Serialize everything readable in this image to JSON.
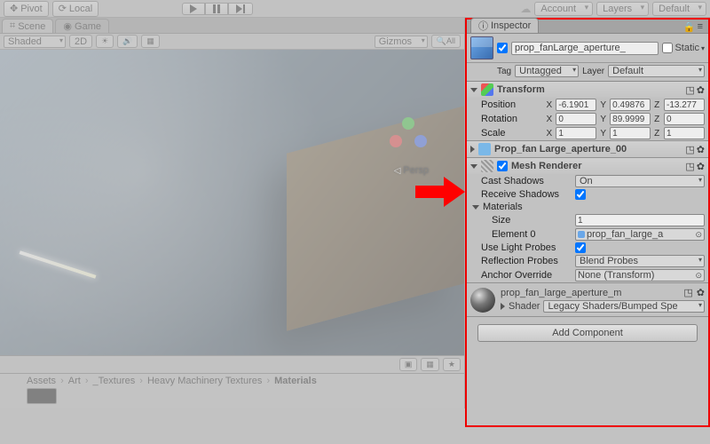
{
  "toolbar": {
    "pivot": "Pivot",
    "local": "Local",
    "account": "Account",
    "layers": "Layers",
    "layout": "Default"
  },
  "scene": {
    "tab_scene": "Scene",
    "tab_game": "Game",
    "shading": "Shaded",
    "mode2d": "2D",
    "gizmos": "Gizmos",
    "persp_label": "Persp"
  },
  "project": {
    "breadcrumb": [
      "Assets",
      "Art",
      "_Textures",
      "Heavy Machinery Textures",
      "Materials"
    ]
  },
  "inspector": {
    "tab": "Inspector",
    "object_name": "prop_fanLarge_aperture_",
    "static_label": "Static",
    "tag_label": "Tag",
    "tag_value": "Untagged",
    "layer_label": "Layer",
    "layer_value": "Default",
    "transform": {
      "title": "Transform",
      "position_label": "Position",
      "rotation_label": "Rotation",
      "scale_label": "Scale",
      "pos": {
        "x": "-6.1901",
        "y": "0.49876",
        "z": "-13.277"
      },
      "rot": {
        "x": "0",
        "y": "89.9999",
        "z": "0"
      },
      "scale": {
        "x": "1",
        "y": "1",
        "z": "1"
      }
    },
    "meshfilter": {
      "title": "Prop_fan Large_aperture_00"
    },
    "renderer": {
      "title": "Mesh Renderer",
      "cast_shadows_label": "Cast Shadows",
      "cast_shadows_value": "On",
      "receive_shadows_label": "Receive Shadows",
      "materials_label": "Materials",
      "size_label": "Size",
      "size_value": "1",
      "element0_label": "Element 0",
      "element0_value": "prop_fan_large_a",
      "use_light_probes_label": "Use Light Probes",
      "reflection_probes_label": "Reflection Probes",
      "reflection_probes_value": "Blend Probes",
      "anchor_override_label": "Anchor Override",
      "anchor_override_value": "None (Transform)"
    },
    "material": {
      "name": "prop_fan_large_aperture_m",
      "shader_label": "Shader",
      "shader_value": "Legacy Shaders/Bumped Spe"
    },
    "add_component": "Add Component"
  }
}
